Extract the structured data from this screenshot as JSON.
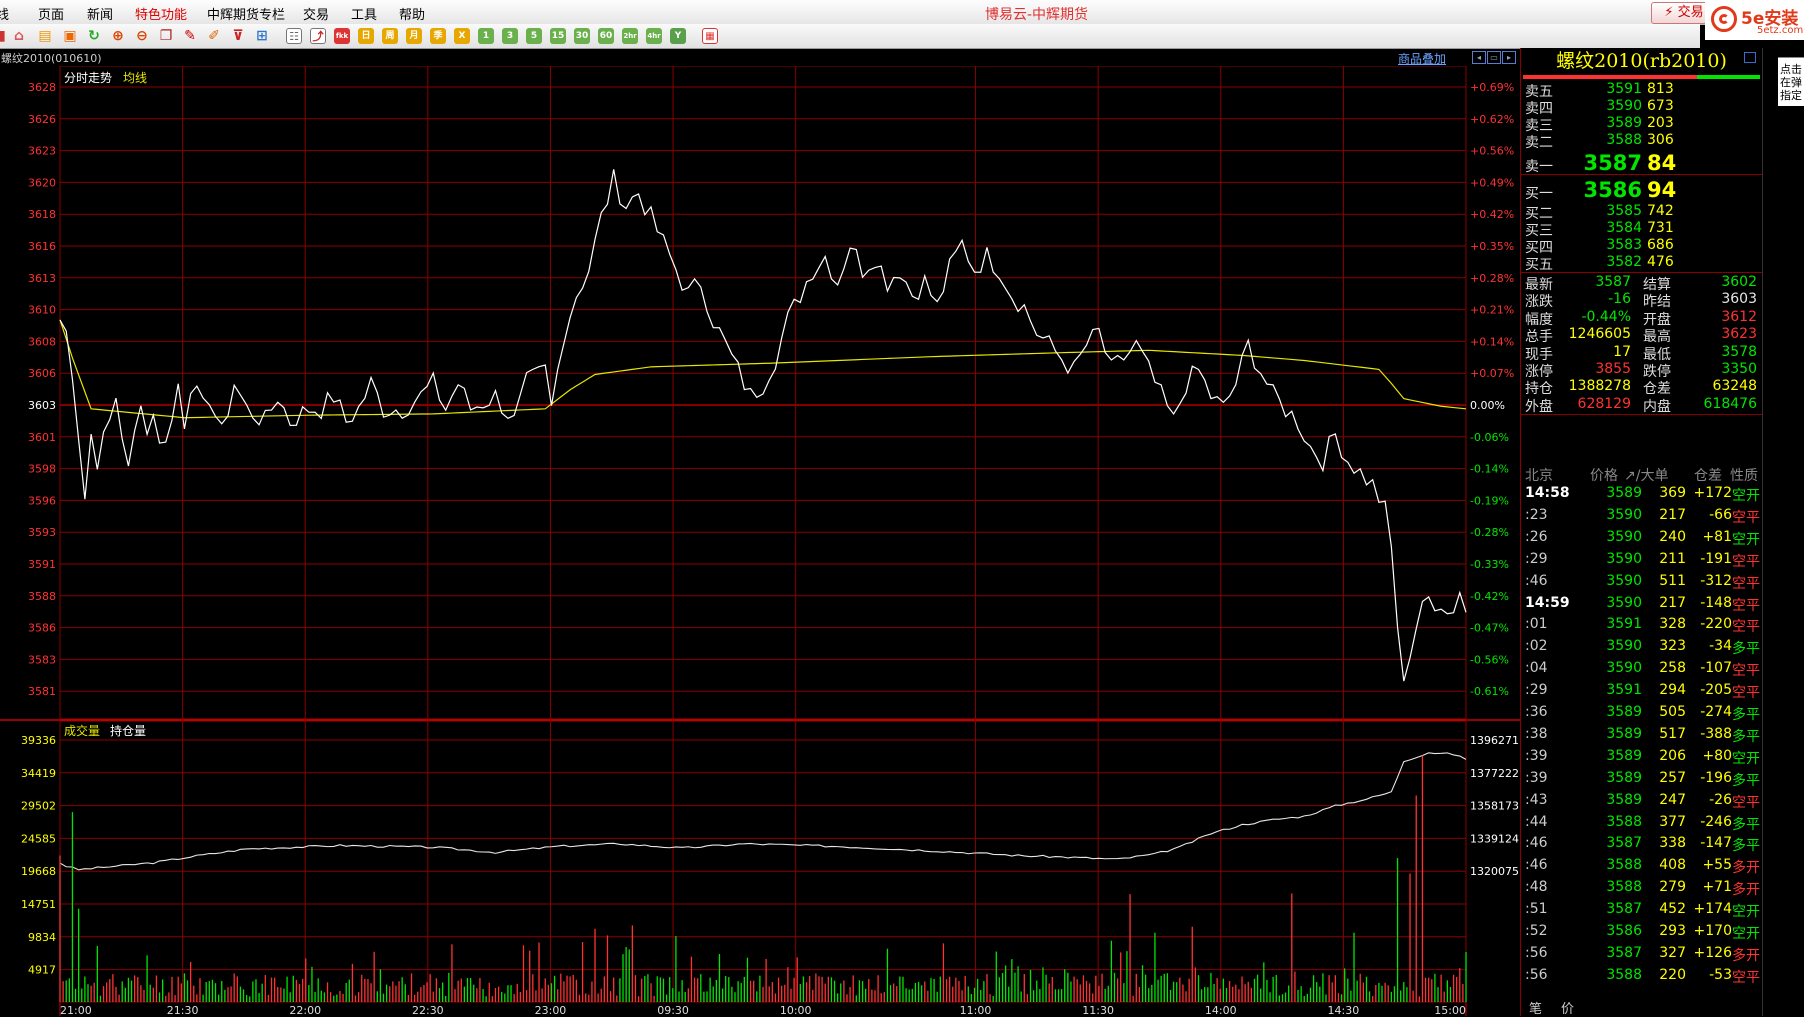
{
  "app_title": "博易云-中辉期货",
  "menu": [
    "线",
    "页面",
    "新闻",
    "特色功能",
    "中辉期货专栏",
    "交易",
    "工具",
    "帮助"
  ],
  "menu_active": "特色功能",
  "trade_button": "交易",
  "logo": {
    "main": "5e安装",
    "sub": "5etz.com"
  },
  "toolbar_icons": [
    "kline-icon",
    "home-icon",
    "folder-icon",
    "news-icon",
    "refresh-icon",
    "zoom-in-icon",
    "zoom-out-icon",
    "window-icon",
    "pen-icon",
    "draw-icon",
    "filter-icon",
    "calculator-icon",
    "table-icon",
    "intraday-icon",
    "fkk",
    "日",
    "周",
    "月",
    "季",
    "X",
    "1",
    "3",
    "5",
    "15",
    "30",
    "60",
    "2hr",
    "4hr",
    "Y",
    "grid-icon"
  ],
  "chart": {
    "symbol_label": "螺纹2010(010610)",
    "overlay_link": "商品叠加",
    "price_legend": [
      "分时走势",
      "均线"
    ],
    "volume_legend": [
      "成交量",
      "持仓量"
    ],
    "prev_settle": 3603,
    "price_ticks": [
      "3628",
      "3626",
      "3623",
      "3620",
      "3618",
      "3616",
      "3613",
      "3610",
      "3608",
      "3606",
      "3603",
      "3601",
      "3598",
      "3596",
      "3593",
      "3591",
      "3588",
      "3586",
      "3583",
      "3581"
    ],
    "pct_ticks": [
      "+0.69%",
      "+0.62%",
      "+0.56%",
      "+0.49%",
      "+0.42%",
      "+0.35%",
      "+0.28%",
      "+0.21%",
      "+0.14%",
      "+0.07%",
      "0.00%",
      "-0.06%",
      "-0.14%",
      "-0.19%",
      "-0.28%",
      "-0.33%",
      "-0.42%",
      "-0.47%",
      "-0.56%",
      "-0.61%"
    ],
    "volume_ticks": [
      "39336",
      "34419",
      "29502",
      "24585",
      "19668",
      "14751",
      "9834",
      "4917"
    ],
    "oi_ticks": [
      "1396271",
      "1377222",
      "1358173",
      "1339124",
      "1320075"
    ],
    "time_ticks": [
      "21:00",
      "21:30",
      "22:00",
      "22:30",
      "23:00",
      "09:30",
      "10:00",
      "11:00",
      "11:30",
      "14:00",
      "14:30",
      "15:00"
    ],
    "price_keypoints": [
      [
        0,
        3610
      ],
      [
        1,
        3609
      ],
      [
        2,
        3606
      ],
      [
        3,
        3601
      ],
      [
        4,
        3596
      ],
      [
        5,
        3601
      ],
      [
        6,
        3599
      ],
      [
        8,
        3602
      ],
      [
        9,
        3604
      ],
      [
        10,
        3601
      ],
      [
        11,
        3598
      ],
      [
        13,
        3604
      ],
      [
        14,
        3601
      ],
      [
        15,
        3603
      ],
      [
        16,
        3600
      ],
      [
        18,
        3602
      ],
      [
        19,
        3605
      ],
      [
        20,
        3602
      ],
      [
        21,
        3605
      ],
      [
        23,
        3603
      ],
      [
        24,
        3604
      ],
      [
        26,
        3601
      ],
      [
        28,
        3605
      ],
      [
        30,
        3603
      ],
      [
        33,
        3602
      ],
      [
        35,
        3604
      ],
      [
        37,
        3602
      ],
      [
        40,
        3603
      ],
      [
        42,
        3603
      ],
      [
        44,
        3604
      ],
      [
        46,
        3602
      ],
      [
        48,
        3603
      ],
      [
        50,
        3605
      ],
      [
        52,
        3603
      ],
      [
        55,
        3603
      ],
      [
        58,
        3604
      ],
      [
        60,
        3605
      ],
      [
        62,
        3603
      ],
      [
        64,
        3605
      ],
      [
        66,
        3603
      ],
      [
        70,
        3604
      ],
      [
        73,
        3602
      ],
      [
        75,
        3605
      ],
      [
        78,
        3606
      ],
      [
        79,
        3603
      ],
      [
        81,
        3609
      ],
      [
        83,
        3612
      ],
      [
        85,
        3614
      ],
      [
        87,
        3618
      ],
      [
        89,
        3621
      ],
      [
        91,
        3619
      ],
      [
        93,
        3620
      ],
      [
        95,
        3618
      ],
      [
        97,
        3616
      ],
      [
        99,
        3614
      ],
      [
        101,
        3612
      ],
      [
        103,
        3613
      ],
      [
        105,
        3610
      ],
      [
        107,
        3608
      ],
      [
        109,
        3606
      ],
      [
        111,
        3604
      ],
      [
        113,
        3605
      ],
      [
        115,
        3607
      ],
      [
        117,
        3610
      ],
      [
        119,
        3612
      ],
      [
        121,
        3614
      ],
      [
        123,
        3615
      ],
      [
        125,
        3613
      ],
      [
        127,
        3616
      ],
      [
        129,
        3614
      ],
      [
        131,
        3615
      ],
      [
        133,
        3613
      ],
      [
        135,
        3614
      ],
      [
        137,
        3612
      ],
      [
        139,
        3613
      ],
      [
        141,
        3611
      ],
      [
        143,
        3614
      ],
      [
        145,
        3616
      ],
      [
        147,
        3614
      ],
      [
        149,
        3615
      ],
      [
        151,
        3614
      ],
      [
        153,
        3612
      ],
      [
        155,
        3611
      ],
      [
        157,
        3609
      ],
      [
        159,
        3608
      ],
      [
        161,
        3607
      ],
      [
        163,
        3606
      ],
      [
        165,
        3608
      ],
      [
        167,
        3609
      ],
      [
        169,
        3606
      ],
      [
        171,
        3607
      ],
      [
        173,
        3608
      ],
      [
        175,
        3606
      ],
      [
        177,
        3604
      ],
      [
        179,
        3602
      ],
      [
        181,
        3605
      ],
      [
        183,
        3606
      ],
      [
        185,
        3604
      ],
      [
        187,
        3603
      ],
      [
        189,
        3605
      ],
      [
        191,
        3608
      ],
      [
        193,
        3606
      ],
      [
        195,
        3604
      ],
      [
        197,
        3603
      ],
      [
        199,
        3602
      ],
      [
        201,
        3600
      ],
      [
        203,
        3599
      ],
      [
        205,
        3601
      ],
      [
        207,
        3599
      ],
      [
        209,
        3598
      ],
      [
        211,
        3597
      ],
      [
        213,
        3595
      ],
      [
        214,
        3592
      ],
      [
        215,
        3586
      ],
      [
        216,
        3581
      ],
      [
        217,
        3584
      ],
      [
        218,
        3586
      ],
      [
        219,
        3588
      ],
      [
        221,
        3587
      ],
      [
        222,
        3588
      ],
      [
        224,
        3587
      ],
      [
        225,
        3589
      ],
      [
        226,
        3587
      ]
    ],
    "avg_keypoints": [
      [
        0,
        3610
      ],
      [
        2,
        3607
      ],
      [
        5,
        3603
      ],
      [
        20,
        3602.3
      ],
      [
        40,
        3602.5
      ],
      [
        60,
        3602.6
      ],
      [
        78,
        3603
      ],
      [
        82,
        3604.5
      ],
      [
        86,
        3605.7
      ],
      [
        95,
        3606.3
      ],
      [
        115,
        3606.6
      ],
      [
        140,
        3607.1
      ],
      [
        160,
        3607.4
      ],
      [
        175,
        3607.6
      ],
      [
        190,
        3607.2
      ],
      [
        200,
        3606.8
      ],
      [
        212,
        3606.1
      ],
      [
        214,
        3605
      ],
      [
        216,
        3603.8
      ],
      [
        222,
        3603.2
      ],
      [
        226,
        3603
      ]
    ],
    "oi_keypoints": [
      [
        0,
        1325000
      ],
      [
        1,
        1323000
      ],
      [
        3,
        1321000
      ],
      [
        15,
        1325000
      ],
      [
        22,
        1329000
      ],
      [
        30,
        1333000
      ],
      [
        45,
        1335000
      ],
      [
        60,
        1334000
      ],
      [
        70,
        1331000
      ],
      [
        80,
        1334500
      ],
      [
        90,
        1336000
      ],
      [
        100,
        1333500
      ],
      [
        110,
        1336000
      ],
      [
        125,
        1334500
      ],
      [
        140,
        1332000
      ],
      [
        155,
        1329000
      ],
      [
        160,
        1328500
      ],
      [
        170,
        1327000
      ],
      [
        176,
        1330000
      ],
      [
        180,
        1334000
      ],
      [
        185,
        1342000
      ],
      [
        190,
        1347000
      ],
      [
        195,
        1350000
      ],
      [
        200,
        1352000
      ],
      [
        205,
        1358000
      ],
      [
        210,
        1362000
      ],
      [
        214,
        1366000
      ],
      [
        216,
        1384000
      ],
      [
        220,
        1389000
      ],
      [
        224,
        1388000
      ],
      [
        226,
        1385000
      ]
    ],
    "volume_spikes": [
      [
        0,
        22000
      ],
      [
        2,
        28500
      ],
      [
        3,
        14000
      ],
      [
        14,
        7000
      ],
      [
        84,
        9000
      ],
      [
        86,
        11000
      ],
      [
        88,
        10000
      ],
      [
        92,
        11500
      ],
      [
        106,
        7200
      ],
      [
        133,
        8000
      ],
      [
        142,
        8800
      ],
      [
        158,
        5200
      ],
      [
        169,
        9200
      ],
      [
        172,
        16200
      ],
      [
        176,
        10400
      ],
      [
        182,
        11300
      ],
      [
        198,
        16300
      ],
      [
        208,
        10400
      ],
      [
        215,
        21600
      ],
      [
        217,
        19300
      ],
      [
        218,
        31000
      ],
      [
        219,
        37000
      ],
      [
        226,
        7500
      ]
    ]
  },
  "quote": {
    "title": "螺纹2010(rb2010)",
    "asks": [
      {
        "label": "卖五",
        "price": "3591",
        "vol": "813",
        "dir": "dn"
      },
      {
        "label": "卖四",
        "price": "3590",
        "vol": "673",
        "dir": "dn"
      },
      {
        "label": "卖三",
        "price": "3589",
        "vol": "203",
        "dir": "dn"
      },
      {
        "label": "卖二",
        "price": "3588",
        "vol": "306",
        "dir": "dn"
      },
      {
        "label": "卖一",
        "price": "3587",
        "vol": "84",
        "dir": "dn"
      }
    ],
    "bids": [
      {
        "label": "买一",
        "price": "3586",
        "vol": "94",
        "dir": "dn"
      },
      {
        "label": "买二",
        "price": "3585",
        "vol": "742",
        "dir": "dn"
      },
      {
        "label": "买三",
        "price": "3584",
        "vol": "731",
        "dir": "dn"
      },
      {
        "label": "买四",
        "price": "3583",
        "vol": "686",
        "dir": "dn"
      },
      {
        "label": "买五",
        "price": "3582",
        "vol": "476",
        "dir": "dn"
      }
    ],
    "stats": [
      {
        "l1": "最新",
        "v1": "3587",
        "c1": "dn",
        "l2": "结算",
        "v2": "3602",
        "c2": "dn"
      },
      {
        "l1": "涨跌",
        "v1": "-16",
        "c1": "dn",
        "l2": "昨结",
        "v2": "3603",
        "c2": "eq"
      },
      {
        "l1": "幅度",
        "v1": "-0.44%",
        "c1": "dn",
        "l2": "开盘",
        "v2": "3612",
        "c2": "up"
      },
      {
        "l1": "总手",
        "v1": "1246605",
        "c1": "yw",
        "l2": "最高",
        "v2": "3623",
        "c2": "up"
      },
      {
        "l1": "现手",
        "v1": "17",
        "c1": "yw",
        "l2": "最低",
        "v2": "3578",
        "c2": "dn"
      },
      {
        "l1": "涨停",
        "v1": "3855",
        "c1": "up",
        "l2": "跌停",
        "v2": "3350",
        "c2": "dn"
      },
      {
        "l1": "持仓",
        "v1": "1388278",
        "c1": "yw",
        "l2": "仓差",
        "v2": "63248",
        "c2": "yw"
      },
      {
        "l1": "外盘",
        "v1": "628129",
        "c1": "up",
        "l2": "内盘",
        "v2": "618476",
        "c2": "dn"
      }
    ],
    "tick_header": [
      "北京",
      "价格",
      "↗/大单",
      "仓差",
      "性质"
    ],
    "ticks": [
      {
        "time": "14:58",
        "full": true,
        "price": "3589",
        "vol": "369",
        "oi": "+172",
        "oi_c": "yw",
        "type": "空开",
        "type_c": "dn"
      },
      {
        "time": ":23",
        "full": false,
        "price": "3590",
        "vol": "217",
        "oi": "-66",
        "oi_c": "yw",
        "type": "空平",
        "type_c": "up"
      },
      {
        "time": ":26",
        "full": false,
        "price": "3590",
        "vol": "240",
        "oi": "+81",
        "oi_c": "yw",
        "type": "空开",
        "type_c": "dn"
      },
      {
        "time": ":29",
        "full": false,
        "price": "3590",
        "vol": "211",
        "oi": "-191",
        "oi_c": "yw",
        "type": "空平",
        "type_c": "up"
      },
      {
        "time": ":46",
        "full": false,
        "price": "3590",
        "vol": "511",
        "oi": "-312",
        "oi_c": "yw",
        "type": "空平",
        "type_c": "up"
      },
      {
        "time": "14:59",
        "full": true,
        "price": "3590",
        "vol": "217",
        "oi": "-148",
        "oi_c": "yw",
        "type": "空平",
        "type_c": "up"
      },
      {
        "time": ":01",
        "full": false,
        "price": "3591",
        "vol": "328",
        "oi": "-220",
        "oi_c": "yw",
        "type": "空平",
        "type_c": "up"
      },
      {
        "time": ":02",
        "full": false,
        "price": "3590",
        "vol": "323",
        "oi": "-34",
        "oi_c": "yw",
        "type": "多平",
        "type_c": "dn"
      },
      {
        "time": ":04",
        "full": false,
        "price": "3590",
        "vol": "258",
        "oi": "-107",
        "oi_c": "yw",
        "type": "空平",
        "type_c": "up"
      },
      {
        "time": ":29",
        "full": false,
        "price": "3591",
        "vol": "294",
        "oi": "-205",
        "oi_c": "yw",
        "type": "空平",
        "type_c": "up"
      },
      {
        "time": ":36",
        "full": false,
        "price": "3589",
        "vol": "505",
        "oi": "-274",
        "oi_c": "yw",
        "type": "多平",
        "type_c": "dn"
      },
      {
        "time": ":38",
        "full": false,
        "price": "3589",
        "vol": "517",
        "oi": "-388",
        "oi_c": "yw",
        "type": "多平",
        "type_c": "dn"
      },
      {
        "time": ":39",
        "full": false,
        "price": "3589",
        "vol": "206",
        "oi": "+80",
        "oi_c": "yw",
        "type": "空开",
        "type_c": "dn"
      },
      {
        "time": ":39",
        "full": false,
        "price": "3589",
        "vol": "257",
        "oi": "-196",
        "oi_c": "yw",
        "type": "多平",
        "type_c": "dn"
      },
      {
        "time": ":43",
        "full": false,
        "price": "3589",
        "vol": "247",
        "oi": "-26",
        "oi_c": "yw",
        "type": "空平",
        "type_c": "up"
      },
      {
        "time": ":44",
        "full": false,
        "price": "3588",
        "vol": "377",
        "oi": "-246",
        "oi_c": "yw",
        "type": "多平",
        "type_c": "dn"
      },
      {
        "time": ":46",
        "full": false,
        "price": "3587",
        "vol": "338",
        "oi": "-147",
        "oi_c": "yw",
        "type": "多平",
        "type_c": "dn"
      },
      {
        "time": ":46",
        "full": false,
        "price": "3588",
        "vol": "408",
        "oi": "+55",
        "oi_c": "yw",
        "type": "多开",
        "type_c": "up"
      },
      {
        "time": ":48",
        "full": false,
        "price": "3588",
        "vol": "279",
        "oi": "+71",
        "oi_c": "yw",
        "type": "多开",
        "type_c": "up"
      },
      {
        "time": ":51",
        "full": false,
        "price": "3587",
        "vol": "452",
        "oi": "+174",
        "oi_c": "yw",
        "type": "空开",
        "type_c": "dn"
      },
      {
        "time": ":52",
        "full": false,
        "price": "3586",
        "vol": "293",
        "oi": "+170",
        "oi_c": "yw",
        "type": "空开",
        "type_c": "dn"
      },
      {
        "time": ":56",
        "full": false,
        "price": "3587",
        "vol": "327",
        "oi": "+126",
        "oi_c": "yw",
        "type": "多开",
        "type_c": "up"
      },
      {
        "time": ":56",
        "full": false,
        "price": "3588",
        "vol": "220",
        "oi": "-53",
        "oi_c": "yw",
        "type": "空平",
        "type_c": "up"
      }
    ],
    "bottom_tabs": [
      "笔",
      "价"
    ]
  },
  "side_tip": "点击在弹指定",
  "colors": {
    "up": "#ff3232",
    "down": "#00e600",
    "grid": "#8a0000",
    "price_line": "#ffffff",
    "avg_line": "#e6e600",
    "volume_axis": "#ffff00",
    "title": "#ffff00"
  }
}
